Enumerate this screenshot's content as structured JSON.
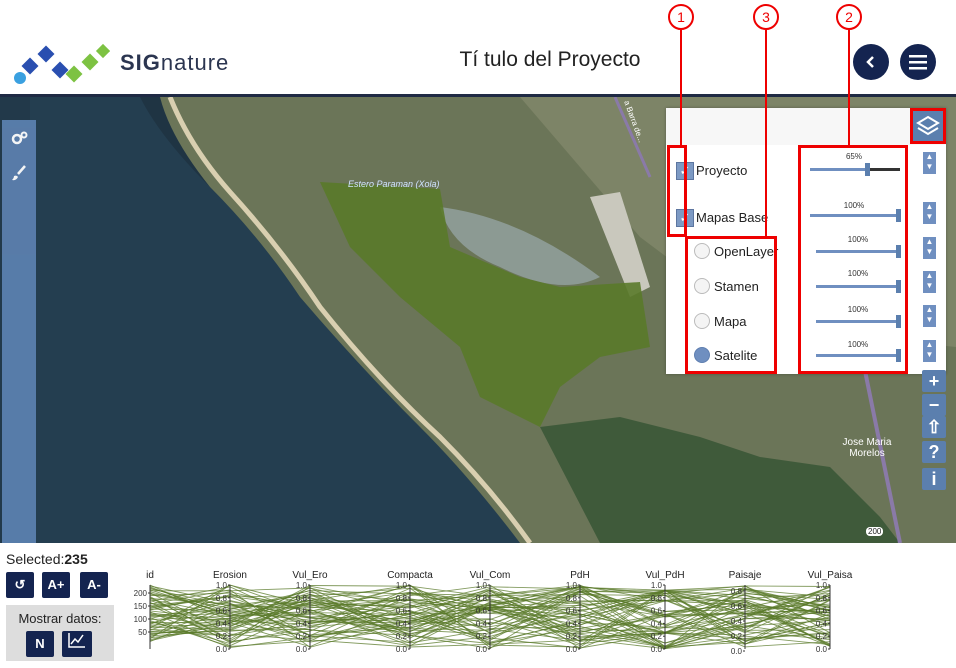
{
  "header": {
    "brand_bold": "SIG",
    "brand_rest": "nature",
    "title": "Tí tulo del Proyecto",
    "back_icon": "chevron-left-icon",
    "menu_icon": "hamburger-menu-icon"
  },
  "map": {
    "labels": [
      {
        "text": "Estero Paraman (Xola)"
      },
      {
        "text": "a Barra de..."
      },
      {
        "text": "Jose Maria Morelos"
      },
      {
        "text": "200"
      }
    ]
  },
  "left_tools": [
    {
      "icon": "gears-icon"
    },
    {
      "icon": "paintbrush-icon"
    }
  ],
  "layers": {
    "groups": [
      {
        "label": "Proyecto",
        "checked": true,
        "opacity": "65%"
      },
      {
        "label": "Mapas Base",
        "checked": true,
        "opacity": "100%"
      }
    ],
    "base_maps": [
      {
        "label": "OpenLayer",
        "selected": false,
        "opacity": "100%"
      },
      {
        "label": "Stamen",
        "selected": false,
        "opacity": "100%"
      },
      {
        "label": "Mapa",
        "selected": false,
        "opacity": "100%"
      },
      {
        "label": "Satelite",
        "selected": true,
        "opacity": "100%"
      }
    ]
  },
  "callouts": [
    "1",
    "3",
    "2"
  ],
  "zoom_controls": [
    "+",
    "−",
    "⇧",
    "?",
    "i"
  ],
  "bottom": {
    "selected_label": "Selected:",
    "selected_count": "235",
    "buttons": [
      "↺",
      "A+",
      "A-"
    ],
    "mostrar_label": "Mostrar datos:",
    "mostrar_buttons": [
      "N",
      "chart-icon"
    ]
  },
  "parallel": {
    "axes": [
      "id",
      "Erosion",
      "Vul_Ero",
      "Compacta",
      "Vul_Com",
      "PdH",
      "Vul_PdH",
      "Paisaje",
      "Vul_Paisa"
    ],
    "id_ticks": [
      "200",
      "150",
      "100",
      "50"
    ],
    "unit_ticks": [
      "1.0",
      "0.8",
      "0.6",
      "0.4",
      "0.2",
      "0.0"
    ],
    "paisaje_ticks": [
      "0.8",
      "0.6",
      "0.4",
      "0.2",
      "0.0"
    ]
  },
  "colors": {
    "navy": "#142450",
    "panel_blue": "#5b7fae",
    "accent_red": "#e00000",
    "polygon_green": "#5a7a2a"
  }
}
